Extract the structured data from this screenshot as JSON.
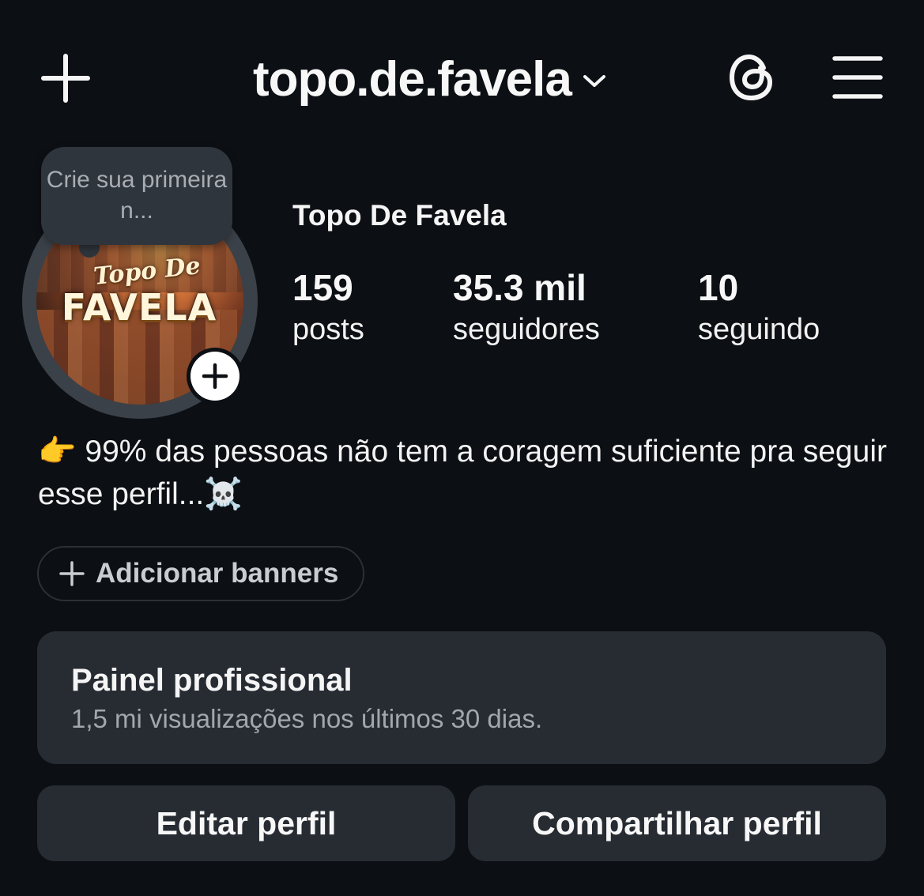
{
  "header": {
    "username": "topo.de.favela"
  },
  "note": {
    "text": "Crie sua primeira n..."
  },
  "avatar": {
    "logo_script": "Topo De",
    "logo_main": "FAVELA"
  },
  "profile": {
    "name": "Topo De Favela",
    "stats": [
      {
        "value": "159",
        "label": "posts"
      },
      {
        "value": "35.3 mil",
        "label": "seguidores"
      },
      {
        "value": "10",
        "label": "seguindo"
      }
    ],
    "bio": "👉 99% das pessoas não tem a coragem suficiente pra seguir esse perfil...☠️"
  },
  "banners": {
    "label": "Adicionar banners"
  },
  "dashboard": {
    "title": "Painel profissional",
    "subtitle": "1,5 mi visualizações nos últimos 30 dias."
  },
  "actions": {
    "edit": "Editar perfil",
    "share": "Compartilhar perfil"
  },
  "colors": {
    "background": "#0c0f14",
    "surface": "#272c33",
    "note_bubble": "#2f353c",
    "text": "#f5f5f5",
    "muted_text": "#a2a7ad"
  },
  "icons": {
    "create": "plus-icon",
    "username_dropdown": "chevron-down-icon",
    "threads": "threads-icon",
    "menu": "hamburger-menu-icon",
    "add_story": "plus-icon",
    "add_banner": "plus-icon"
  }
}
